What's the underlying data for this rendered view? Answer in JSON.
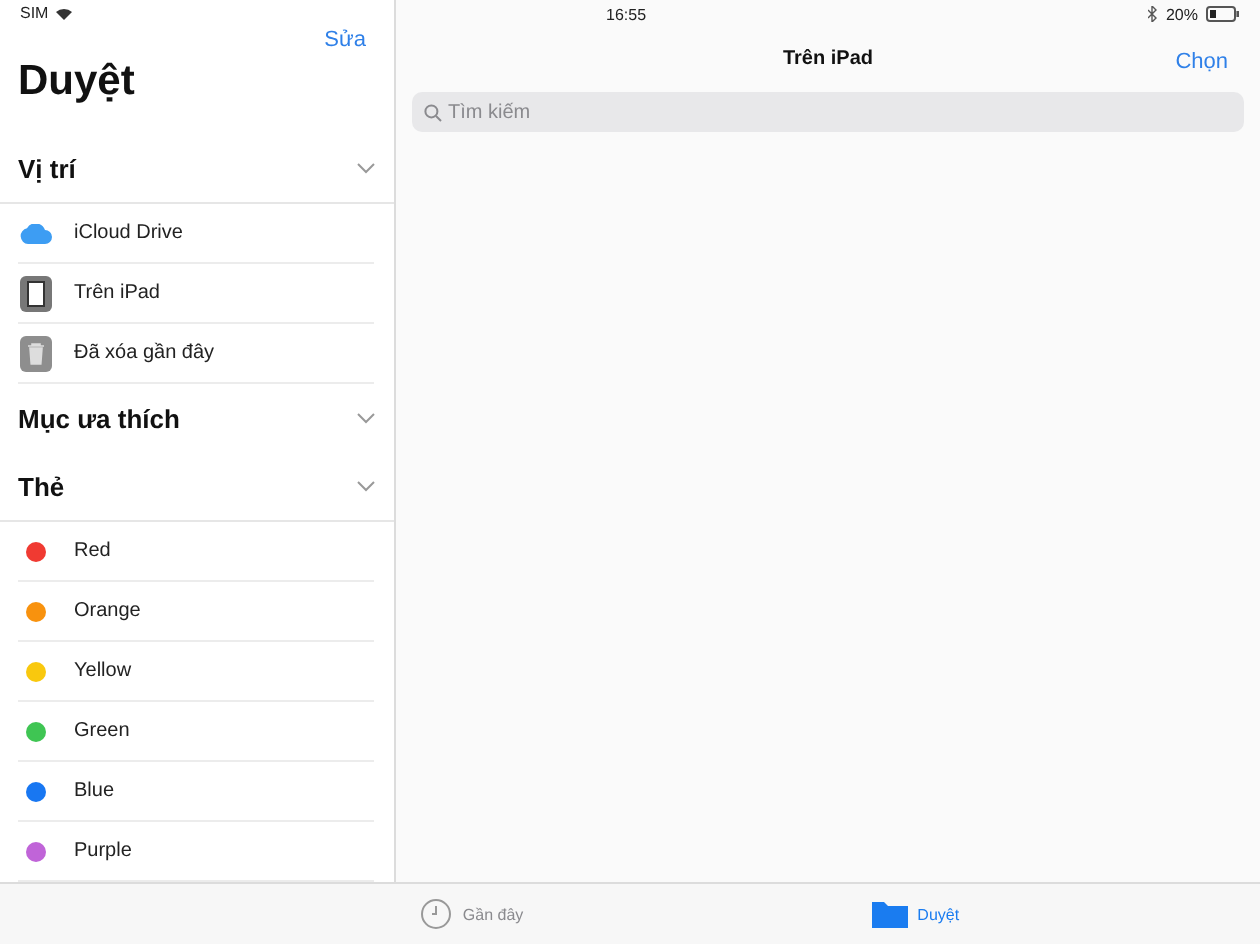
{
  "status_bar": {
    "carrier": "SIM",
    "time": "16:55",
    "battery": "20%"
  },
  "sidebar": {
    "edit_button": "Sửa",
    "title": "Duyệt",
    "sections": [
      {
        "title": "Vị trí",
        "expanded": true,
        "items": [
          {
            "kind": "cloud",
            "label": "iCloud Drive",
            "selected": false
          },
          {
            "kind": "device",
            "label": "Trên iPad",
            "selected": false
          },
          {
            "kind": "trash",
            "label": "Đã xóa gần đây",
            "selected": false
          }
        ]
      },
      {
        "title": "Mục ưa thích",
        "expanded": true
      },
      {
        "title": "Thẻ",
        "expanded": true,
        "items": [
          {
            "kind": "tag",
            "label": "Red",
            "color": "#f03a32",
            "selected": false
          },
          {
            "kind": "tag",
            "label": "Orange",
            "color": "#f8920e",
            "selected": false
          },
          {
            "kind": "tag",
            "label": "Yellow",
            "color": "#f9c80e",
            "selected": false
          },
          {
            "kind": "tag",
            "label": "Green",
            "color": "#3fc553",
            "selected": false
          },
          {
            "kind": "tag",
            "label": "Blue",
            "color": "#1877f2",
            "selected": false
          },
          {
            "kind": "tag",
            "label": "Purple",
            "color": "#c064d8",
            "selected": false
          }
        ]
      }
    ]
  },
  "main": {
    "title": "Trên iPad",
    "select_button": "Chọn",
    "search": {
      "placeholder": "Tìm kiếm"
    }
  },
  "tab_bar": [
    {
      "kind": "recent",
      "label": "Gần đây",
      "selected": false
    },
    {
      "kind": "browse",
      "label": "Duyệt",
      "selected": true
    }
  ]
}
